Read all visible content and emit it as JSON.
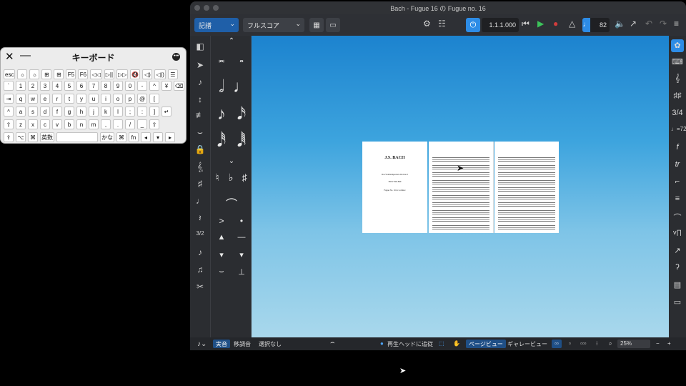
{
  "keyboard": {
    "title": "キーボード",
    "rows": [
      [
        "esc",
        "☼",
        "☼",
        "⊞",
        "⊞",
        "F5",
        "F6",
        "◁◁",
        "▷||",
        "▷▷",
        "🔇",
        "◁)",
        "◁))",
        "☰"
      ],
      [
        "`",
        "1",
        "2",
        "3",
        "4",
        "5",
        "6",
        "7",
        "8",
        "9",
        "0",
        "-",
        "^",
        "¥",
        "⌫"
      ],
      [
        "⇥",
        "q",
        "w",
        "e",
        "r",
        "t",
        "y",
        "u",
        "i",
        "o",
        "p",
        "@",
        "["
      ],
      [
        "^",
        "a",
        "s",
        "d",
        "f",
        "g",
        "h",
        "j",
        "k",
        "l",
        ";",
        ":",
        "]",
        "↵"
      ],
      [
        "⇧",
        "z",
        "x",
        "c",
        "v",
        "b",
        "n",
        "m",
        ",",
        ".",
        "/",
        "_",
        "⇧"
      ],
      [
        "⇪",
        "⌥",
        "⌘",
        "英数",
        " ",
        "かな",
        "⌘",
        "fn",
        "◂",
        "▾",
        "▸"
      ]
    ]
  },
  "app": {
    "window_title": "Bach - Fugue 16 の Fugue no. 16",
    "toolbar": {
      "mode_dropdown": "記譜",
      "layout_dropdown": "フルスコア",
      "counter": "1.1.1.000",
      "tempo": "82"
    },
    "score": {
      "title_page": {
        "composer": "J.S. BACH",
        "work": "Das Wohltemperierte Klavier I",
        "catalog": "BWV 846-869",
        "editor": "Fugue No. 16 in G minor"
      }
    },
    "status": {
      "concert_pitch": "実音",
      "transposed": "移調音",
      "selection": "選択なし",
      "follow_playhead": "再生ヘッドに追従",
      "page_view": "ページビュー",
      "galley_view": "ギャレービュー",
      "zoom": "25%"
    }
  }
}
